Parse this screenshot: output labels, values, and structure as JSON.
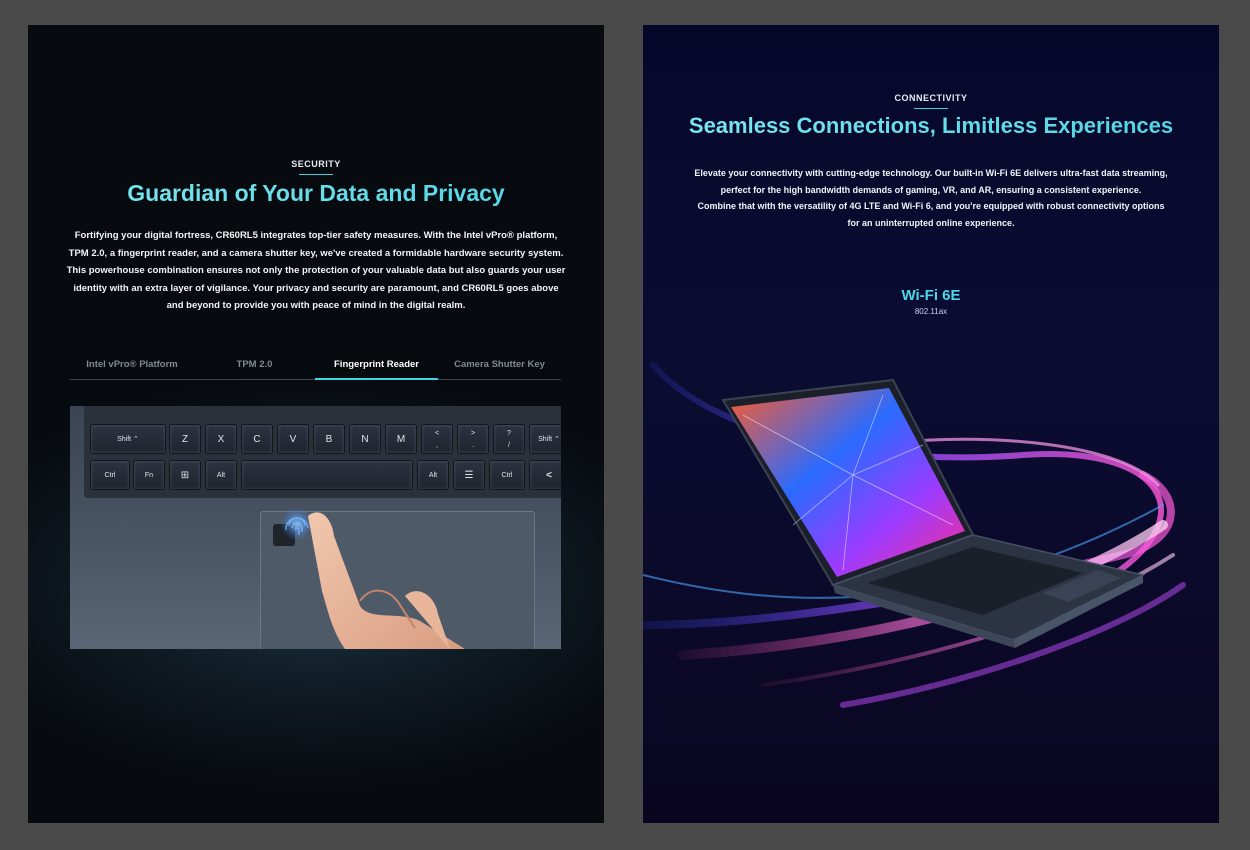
{
  "security": {
    "eyebrow": "SECURITY",
    "headline": "Guardian of Your Data and Privacy",
    "body_lines": [
      "Fortifying your digital fortress, CR60RL5 integrates top-tier safety measures. With the Intel vPro® platform,",
      "TPM 2.0, a fingerprint reader, and a camera shutter key, we've created a formidable hardware security system.",
      "This powerhouse combination ensures not only the protection of your valuable data but also guards your user",
      "identity with an extra layer of vigilance. Your privacy and security are paramount, and CR60RL5 goes above",
      "and beyond to provide you with peace of mind in the digital realm."
    ],
    "tabs": [
      {
        "label": "Intel vPro® Platform",
        "active": false
      },
      {
        "label": "TPM 2.0",
        "active": false
      },
      {
        "label": "Fingerprint Reader",
        "active": true
      },
      {
        "label": "Camera Shutter Key",
        "active": false
      }
    ],
    "keyboard": {
      "row1": [
        "Shift ⌃",
        "Z",
        "X",
        "C",
        "V",
        "B",
        "N",
        "M",
        "<\n,",
        ">\n.",
        "?\n/",
        "Shift ⌃"
      ],
      "row2": [
        "Ctrl",
        "Fn",
        "⊞",
        "Alt",
        "",
        "Alt",
        "☰",
        "Ctrl",
        "<"
      ]
    }
  },
  "connectivity": {
    "eyebrow": "CONNECTIVITY",
    "headline": "Seamless Connections, Limitless Experiences",
    "body_lines": [
      "Elevate your connectivity with cutting-edge technology. Our built-in Wi-Fi 6E delivers ultra-fast data streaming,",
      "perfect for the high bandwidth demands of gaming, VR, and AR, ensuring a consistent experience.",
      "Combine that with the versatility of 4G LTE and Wi-Fi 6, and you're equipped with robust connectivity options",
      "for an uninterrupted online experience."
    ],
    "wifi_title": "Wi-Fi 6E",
    "wifi_sub": "802.11ax"
  },
  "colors": {
    "accent": "#49d8e6",
    "left_bg": "#070a0e",
    "right_bg": "#080a2c",
    "page_bg": "#4a4a4a"
  }
}
